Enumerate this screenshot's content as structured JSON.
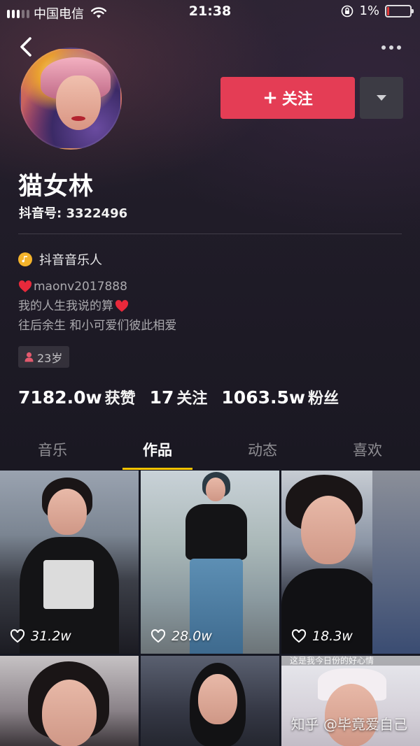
{
  "status_bar": {
    "carrier": "中国电信",
    "time": "21:38",
    "battery": "1%"
  },
  "profile": {
    "nickname": "猫女林",
    "douyin_id": "抖音号: 3322496",
    "verified_label": "抖音音乐人",
    "bio_lines": [
      "maonv2017888",
      "我的人生我说的算",
      "往后余生 和小可爱们彼此相爱"
    ],
    "age": "23岁"
  },
  "actions": {
    "follow_label": "关注"
  },
  "stats": {
    "likes_num": "7182.0w",
    "likes_label": "获赞",
    "following_num": "17",
    "following_label": "关注",
    "followers_num": "1063.5w",
    "followers_label": "粉丝"
  },
  "tabs": [
    {
      "label": "音乐"
    },
    {
      "label": "作品"
    },
    {
      "label": "动态"
    },
    {
      "label": "喜欢"
    }
  ],
  "videos": [
    {
      "likes": "31.2w"
    },
    {
      "likes": "28.0w"
    },
    {
      "likes": "18.3w"
    },
    {
      "likes": ""
    },
    {
      "likes": ""
    },
    {
      "likes": ""
    }
  ],
  "video_caption_6": "这是我今日份的好心情",
  "watermark": "知乎 @毕竟爱自己",
  "colors": {
    "follow_button": "#e43d55",
    "tab_indicator": "#f7c400",
    "background": "#161823"
  }
}
